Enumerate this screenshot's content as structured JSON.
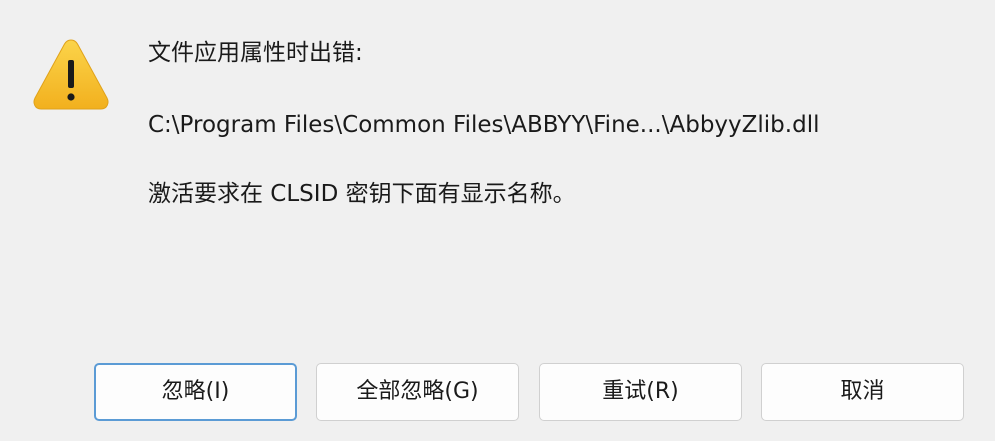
{
  "dialog": {
    "icon": "warning-icon",
    "message_heading": "文件应用属性时出错:",
    "file_path": "C:\\Program Files\\Common Files\\ABBYY\\Fine...\\AbbyyZlib.dll",
    "error_detail": "激活要求在 CLSID 密钥下面有显示名称。"
  },
  "buttons": {
    "ignore": "忽略(I)",
    "ignore_all": "全部忽略(G)",
    "retry": "重试(R)",
    "cancel": "取消"
  },
  "colors": {
    "background": "#f0f0f0",
    "warning_yellow": "#f7c226",
    "focus_border": "#5b9bd5"
  }
}
